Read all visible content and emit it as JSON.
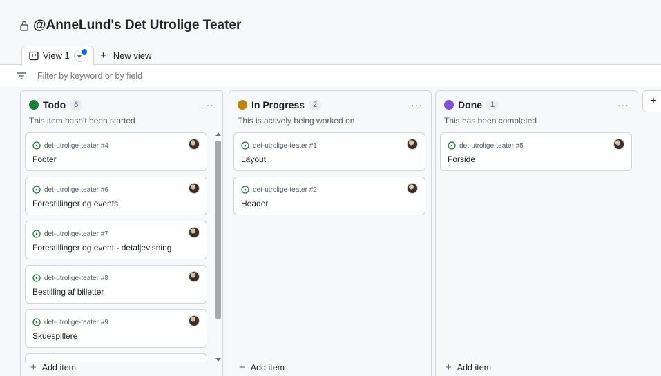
{
  "project": {
    "title": "@AnneLund's Det Utrolige Teater"
  },
  "tabs": {
    "active_label": "View 1",
    "new_view_label": "New view"
  },
  "filter": {
    "placeholder": "Filter by keyword or by field"
  },
  "columns": [
    {
      "name": "Todo",
      "count": "6",
      "color": "#1a7f37",
      "description": "This item hasn't been started",
      "cards": [
        {
          "ref": "det-utrolige-teater #4",
          "title": "Footer"
        },
        {
          "ref": "det-utrolige-teater #6",
          "title": "Forestillinger og events"
        },
        {
          "ref": "det-utrolige-teater #7",
          "title": "Forestillinger og event - detaljevisning"
        },
        {
          "ref": "det-utrolige-teater #8",
          "title": "Bestilling af billetter"
        },
        {
          "ref": "det-utrolige-teater #9",
          "title": "Skuespillere"
        }
      ],
      "add_label": "Add item"
    },
    {
      "name": "In Progress",
      "count": "2",
      "color": "#bf8700",
      "description": "This is actively being worked on",
      "cards": [
        {
          "ref": "det-utrolige-teater #1",
          "title": "Layout"
        },
        {
          "ref": "det-utrolige-teater #2",
          "title": "Header"
        }
      ],
      "add_label": "Add item"
    },
    {
      "name": "Done",
      "count": "1",
      "color": "#8250df",
      "description": "This has been completed",
      "cards": [
        {
          "ref": "det-utrolige-teater #5",
          "title": "Forside"
        }
      ],
      "add_label": "Add item"
    }
  ],
  "icons": {
    "lock": "lock-icon",
    "board_view": "board-view-icon",
    "filter": "filter-icon",
    "issue_open": "issue-opened-icon",
    "more": "kebab-horizontal-icon",
    "plus": "plus-icon"
  },
  "colors": {
    "issue_open": "#1a7f37",
    "accent": "#0969da"
  }
}
